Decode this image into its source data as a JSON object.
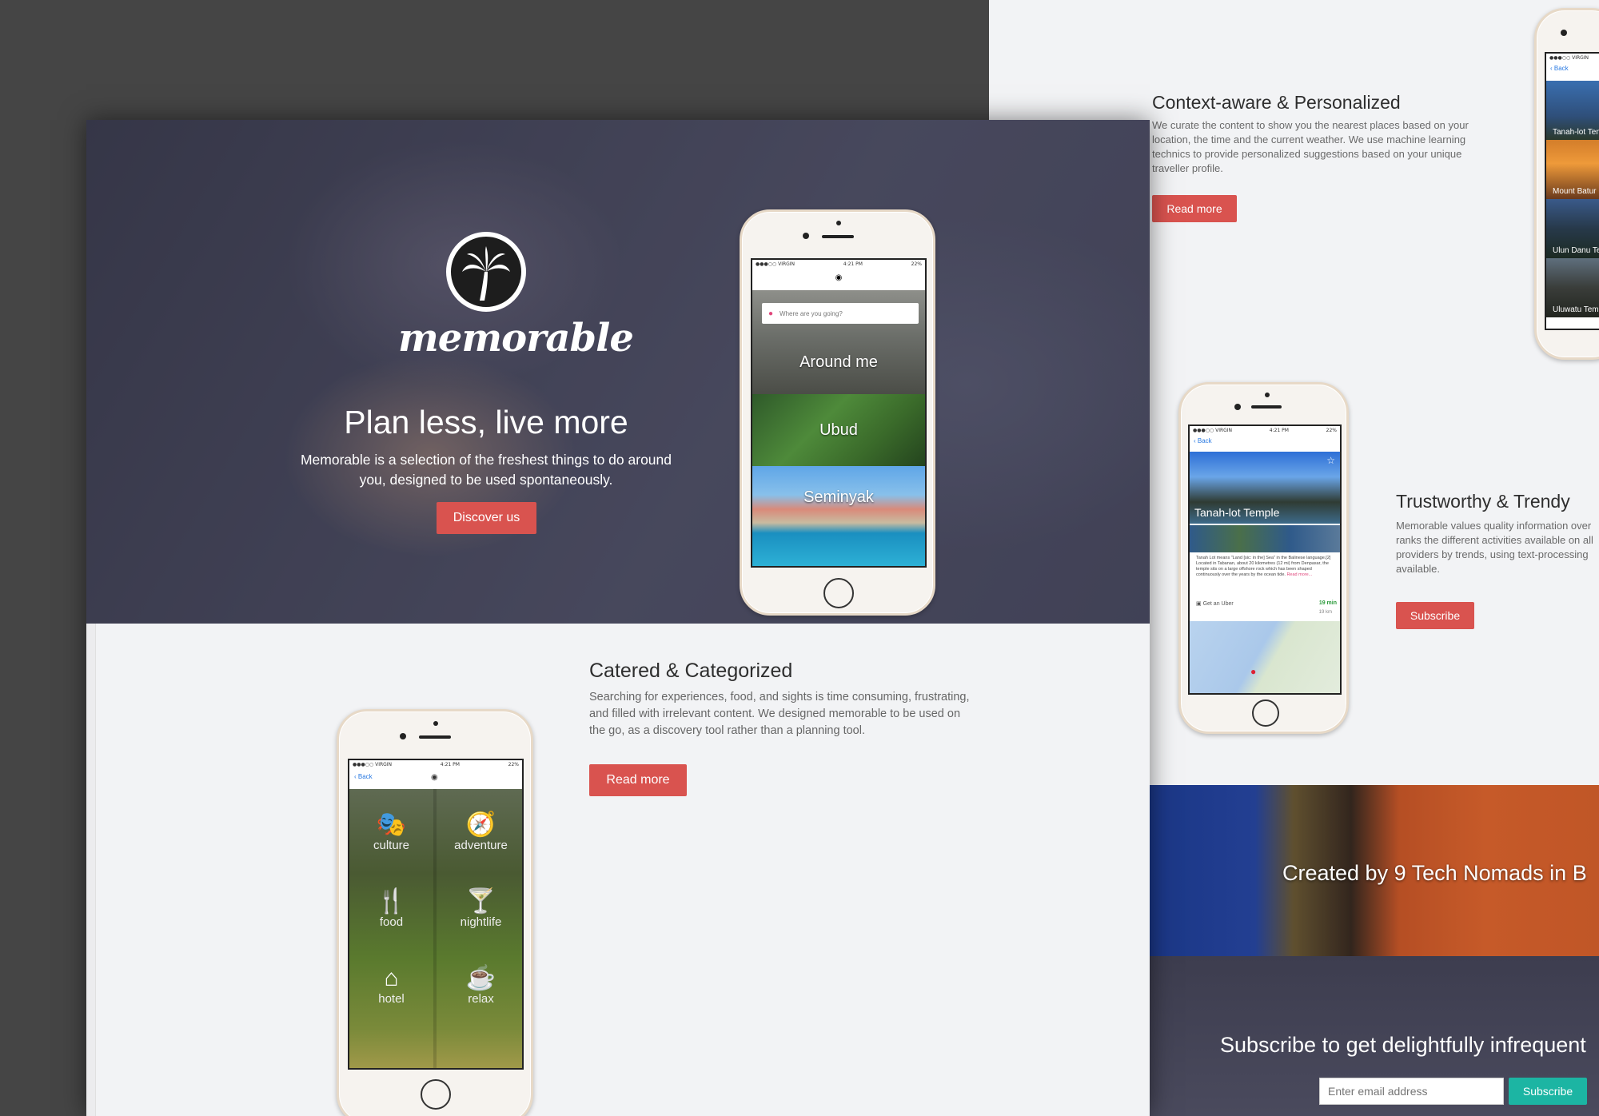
{
  "hero": {
    "logo_text": "memorable",
    "title": "Plan less, live more",
    "subtitle_line1": "Memorable is a selection of the freshest things to do around",
    "subtitle_line2": "you, designed to be used spontaneously.",
    "cta": "Discover us"
  },
  "hero_phone": {
    "status_left": "●●●○○ VIRGIN",
    "status_time": "4:21 PM",
    "status_right": "22%",
    "search_placeholder": "Where are you going?",
    "tiles": [
      "Around me",
      "Ubud",
      "Seminyak"
    ]
  },
  "categories_section": {
    "title": "Catered & Categorized",
    "text": "Searching for experiences, food, and sights is time consuming, frustrating, and filled with irrelevant content. We designed memorable to be used on the go, as a discovery tool rather than a planning tool.",
    "button": "Read more"
  },
  "grid_phone": {
    "status_left": "●●●○○ VIRGIN",
    "status_time": "4:21 PM",
    "status_right": "22%",
    "back": "Back",
    "cells": [
      {
        "label": "culture",
        "icon": "🎭"
      },
      {
        "label": "adventure",
        "icon": "🧭"
      },
      {
        "label": "food",
        "icon": "🍴"
      },
      {
        "label": "nightlife",
        "icon": "🍸"
      },
      {
        "label": "hotel",
        "icon": "⌂"
      },
      {
        "label": "relax",
        "icon": "☕"
      }
    ]
  },
  "context_section": {
    "title": "Context-aware & Personalized",
    "text": "We curate the content to show you the nearest places based on your location, the time and the current weather. We use machine learning technics to provide personalized suggestions based on your unique traveller profile.",
    "button": "Read more"
  },
  "list_phone": {
    "back": "Back",
    "status_left": "●●●○○ VIRGIN",
    "items": [
      "Tanah-lot Ten",
      "Mount Batur",
      "Ulun Danu Te",
      "Uluwatu Tem"
    ]
  },
  "trust_section": {
    "title": "Trustworthy & Trendy",
    "text": "Memorable values quality information over ranks the different activities available on all providers by trends, using text-processing available.",
    "button": "Subscribe"
  },
  "detail_phone": {
    "back": "Back",
    "status_left": "●●●○○ VIRGIN",
    "status_time": "4:21 PM",
    "status_right": "22%",
    "place": "Tanah-lot Temple",
    "desc": "Tanah Lot means \"Land [sic: in the] Sea\" in the Balinese language.[2] Located in Tabanan, about 20 kilometres (12 mi) from Denpasar, the temple sits on a large offshore rock which has been shaped continuously over the years by the ocean tide.",
    "read_more": "Read more...",
    "uber": "Get an Uber",
    "eta": "19 min",
    "distance": "19 km"
  },
  "team_banner": {
    "text": "Created by 9 Tech Nomads in B"
  },
  "subscribe_section": {
    "title": "Subscribe to get delightfully infrequent",
    "placeholder": "Enter email address",
    "button": "Subscribe"
  },
  "colors": {
    "accent_red": "#d9534f",
    "teal": "#1cb5a3"
  }
}
